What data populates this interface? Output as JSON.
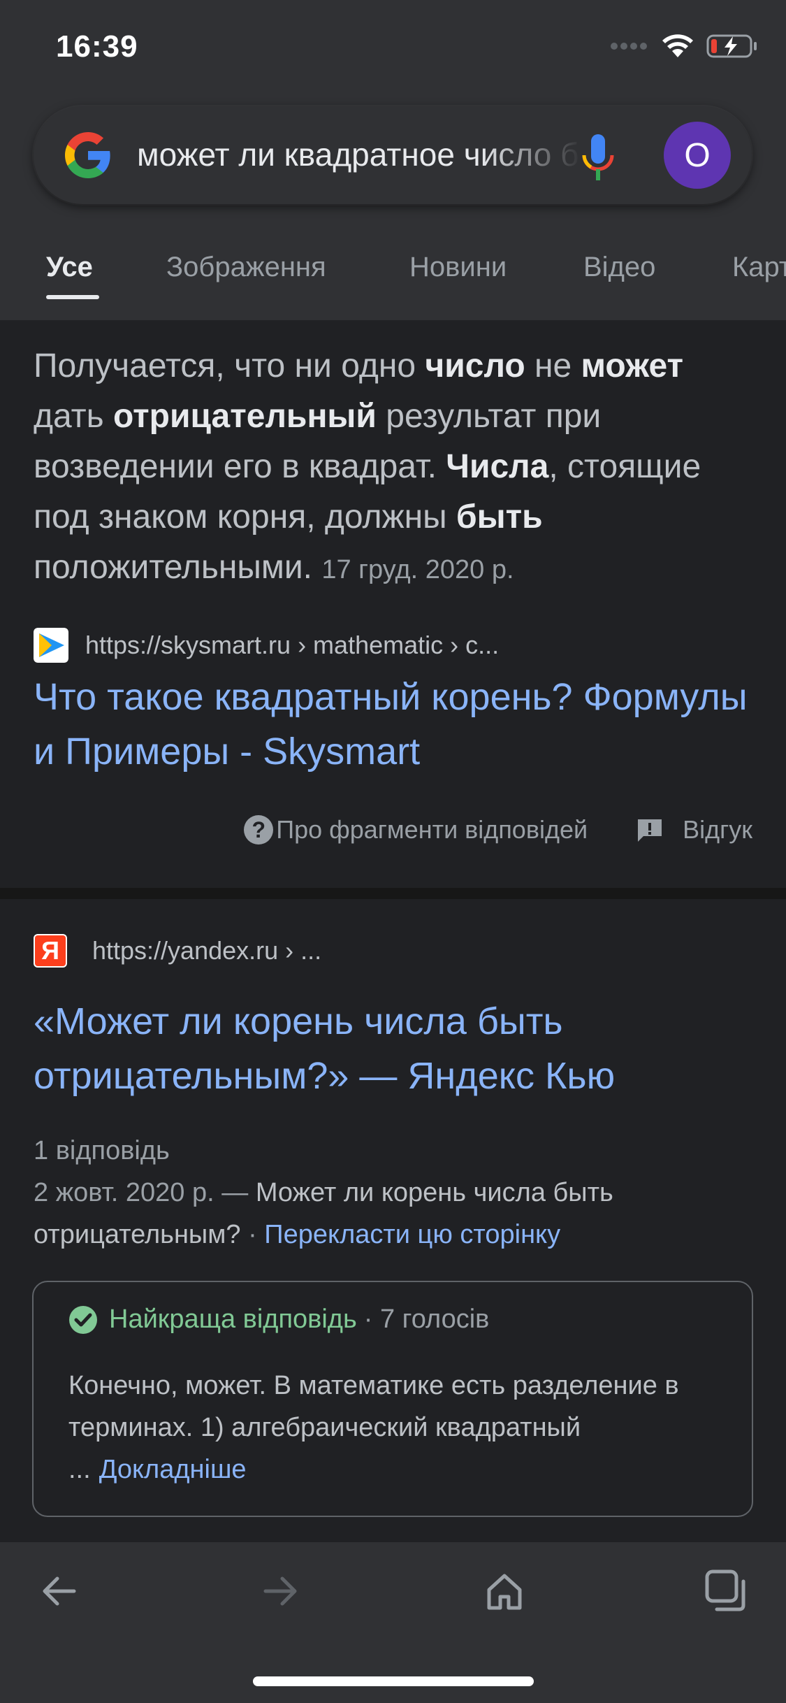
{
  "status": {
    "time": "16:39",
    "icons": [
      "signal-dots-icon",
      "wifi-icon",
      "battery-charging-icon"
    ]
  },
  "search": {
    "query": "может ли квадратное число быть отрицательным",
    "logo": "google-g-icon",
    "mic": "microphone-icon",
    "avatar_letter": "O"
  },
  "tabs": [
    {
      "label": "Усе",
      "active": true
    },
    {
      "label": "Зображення",
      "active": false
    },
    {
      "label": "Новини",
      "active": false
    },
    {
      "label": "Відео",
      "active": false
    },
    {
      "label": "Карти",
      "active": false
    }
  ],
  "featured": {
    "snippet": {
      "p1": "Получается, что ни одно ",
      "b1": "число",
      "p2": " не ",
      "b2": "может",
      "p3": " дать ",
      "b3": "отрицательный",
      "p4": " результат при возведении его в квадрат. ",
      "b4": "Числа",
      "p5": ", стоящие под знаком корня, должны ",
      "b5": "быть",
      "p6": " положительными.",
      "date": "17 груд. 2020 р."
    },
    "url": "https://skysmart.ru › mathematic › c...",
    "title": "Что такое квадратный корень? Формулы и Примеры - Skysmart",
    "about_label": "Про фрагменти відповідей",
    "feedback_label": "Відгук"
  },
  "result2": {
    "url": "https://yandex.ru › ...",
    "favicon_letter": "Я",
    "title": "«Может ли корень числа быть отрицательным?» — Яндекс Кью",
    "answers_count": "1 відповідь",
    "date": "2 жовт. 2020 р.",
    "desc": "Может ли корень числа быть отрицательным?",
    "separator": " — ",
    "dot": " · ",
    "translate_link": "Перекласти цю сторінку",
    "best_answer_label": "Найкраща відповідь",
    "votes": "· 7 голосів",
    "answer_text": "Конечно, может. В математике есть разделение в терминах. 1) алгебраический квадратный ...",
    "more_link": "Докладніше"
  },
  "bottom_nav": [
    "back-arrow-icon",
    "forward-arrow-icon",
    "home-icon",
    "tabs-icon"
  ],
  "colors": {
    "background": "#202124",
    "surface": "#303134",
    "link": "#8ab4f8",
    "best_answer": "#81c995",
    "avatar": "#5e35b1"
  }
}
